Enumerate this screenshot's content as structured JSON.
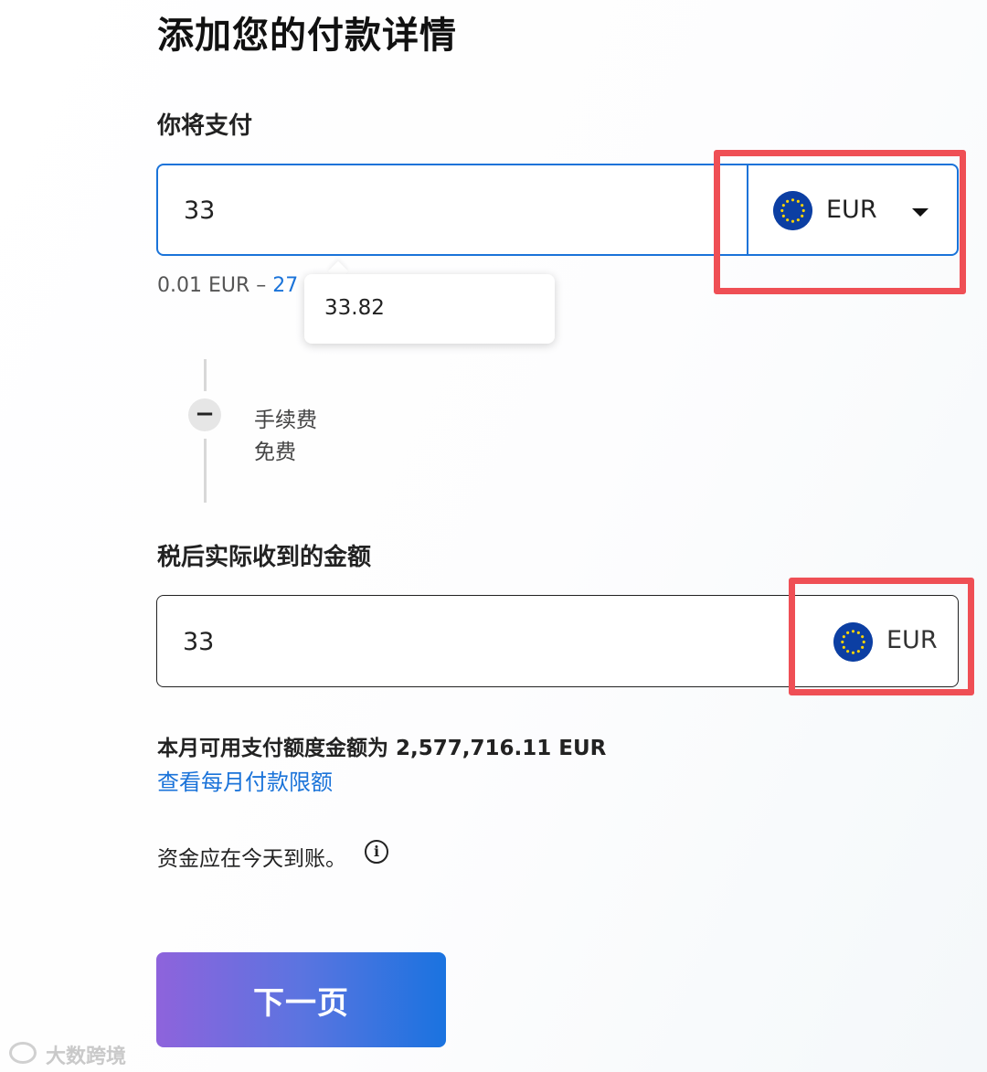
{
  "page": {
    "title": "添加您的付款详情"
  },
  "pay": {
    "label": "你将支付",
    "amount": "33",
    "currency": "EUR",
    "range_min": "0.01 EUR –",
    "range_max": "27",
    "tooltip_value": "33.82"
  },
  "fee": {
    "label": "手续费",
    "value": "免费"
  },
  "receive": {
    "label": "税后实际收到的金额",
    "amount": "33",
    "currency": "EUR"
  },
  "limit": {
    "text": "本月可用支付额度金额为 2,577,716.11 EUR",
    "link": "查看每月付款限额"
  },
  "arrival": {
    "text": "资金应在今天到账。",
    "info_icon": "i"
  },
  "actions": {
    "next_label": "下一页"
  },
  "watermark": {
    "text": "大数跨境"
  },
  "colors": {
    "accent_blue": "#1a73d9",
    "highlight_red": "#ef4f55",
    "eu_flag_blue": "#0c3fa3",
    "eu_star_yellow": "#ffd500",
    "button_gradient_start": "#8e63dc",
    "button_gradient_end": "#1a73e0"
  },
  "icons": [
    "eu-flag-icon",
    "caret-down-icon",
    "minus-icon",
    "info-icon"
  ]
}
